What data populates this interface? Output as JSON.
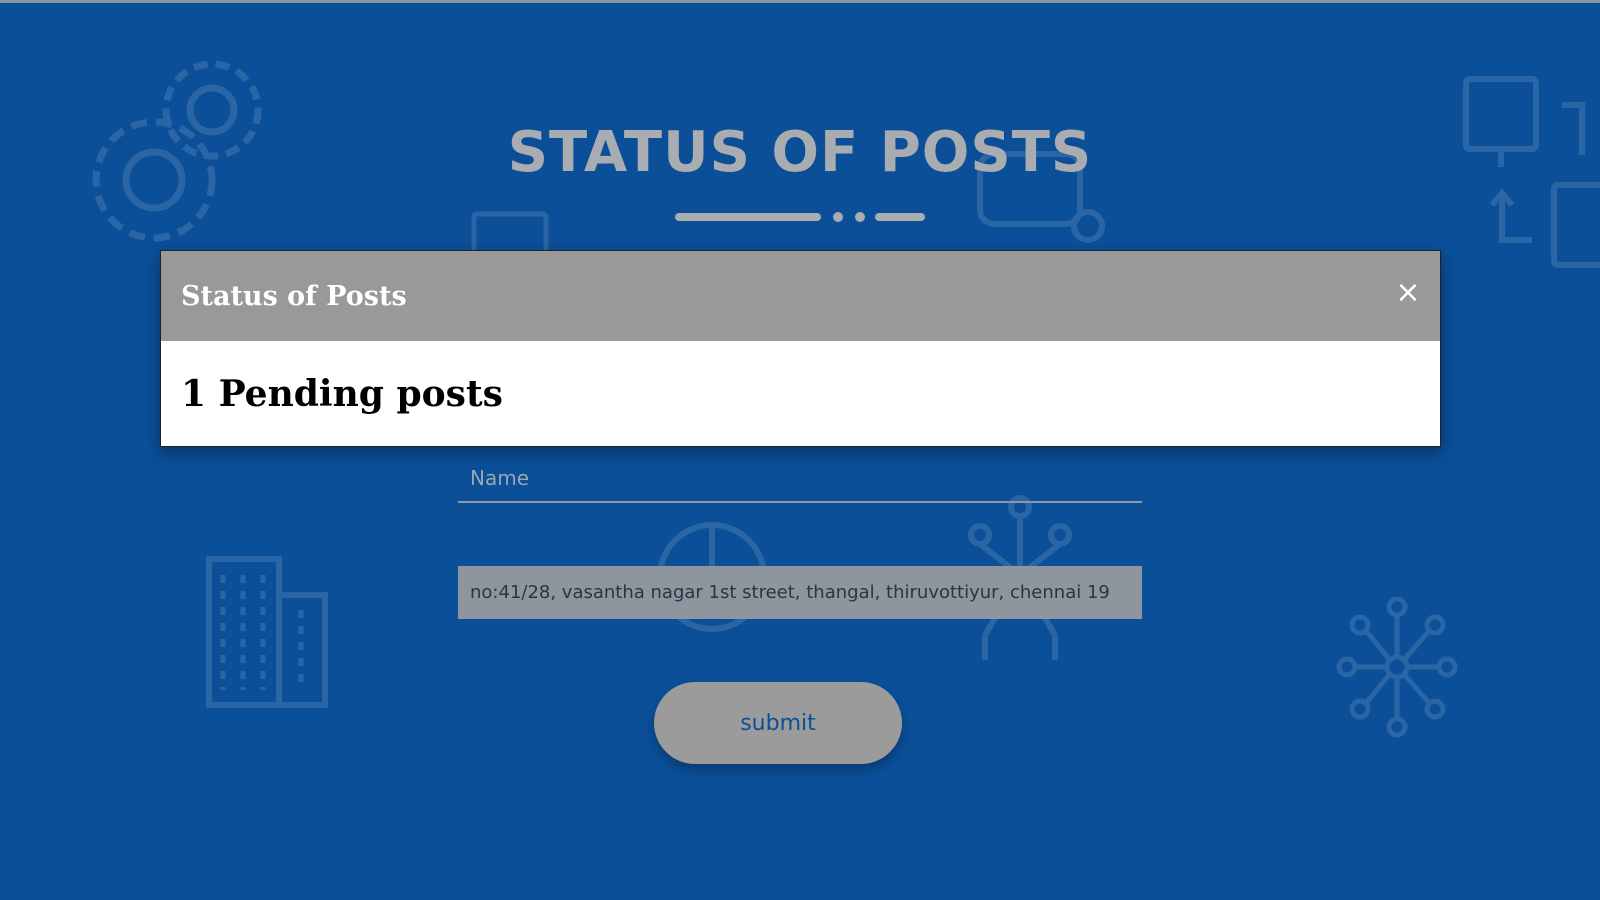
{
  "page": {
    "heading": "STATUS OF POSTS",
    "colors": {
      "background": "#0a4f98",
      "heading": "#a9acb0",
      "button_bg": "#9b9b9b",
      "button_text": "#0a4f98"
    }
  },
  "form": {
    "name_placeholder": "Name",
    "address_value": "no:41/28, vasantha nagar 1st street, thangal, thiruvottiyur, chennai 19",
    "submit_label": "submit"
  },
  "modal": {
    "title": "Status of Posts",
    "close_glyph": "×",
    "message": "1 Pending posts",
    "colors": {
      "header_bg": "#999999",
      "header_text": "#ffffff",
      "body_bg": "#ffffff"
    }
  },
  "icons": [
    "gears-icon",
    "monitor-icon",
    "building-icon",
    "pie-chart-icon",
    "network-icon",
    "hub-icon",
    "devices-icon",
    "sync-icon"
  ]
}
